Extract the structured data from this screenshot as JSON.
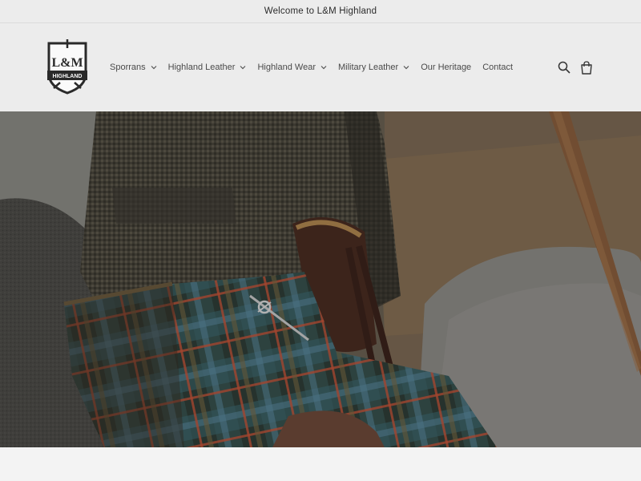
{
  "announcement": {
    "text": "Welcome to L&M Highland"
  },
  "logo": {
    "line1": "L&M",
    "line2": "HIGHLAND"
  },
  "nav": {
    "items": [
      {
        "label": "Sporrans",
        "has_dropdown": true
      },
      {
        "label": "Highland Leather",
        "has_dropdown": true
      },
      {
        "label": "Highland Wear",
        "has_dropdown": true
      },
      {
        "label": "Military Leather",
        "has_dropdown": true
      },
      {
        "label": "Our Heritage",
        "has_dropdown": false
      },
      {
        "label": "Contact",
        "has_dropdown": false
      }
    ]
  },
  "icons": {
    "search": "search-icon",
    "cart": "cart-icon"
  },
  "colors": {
    "header_bg": "#ececec",
    "text": "#333333"
  }
}
